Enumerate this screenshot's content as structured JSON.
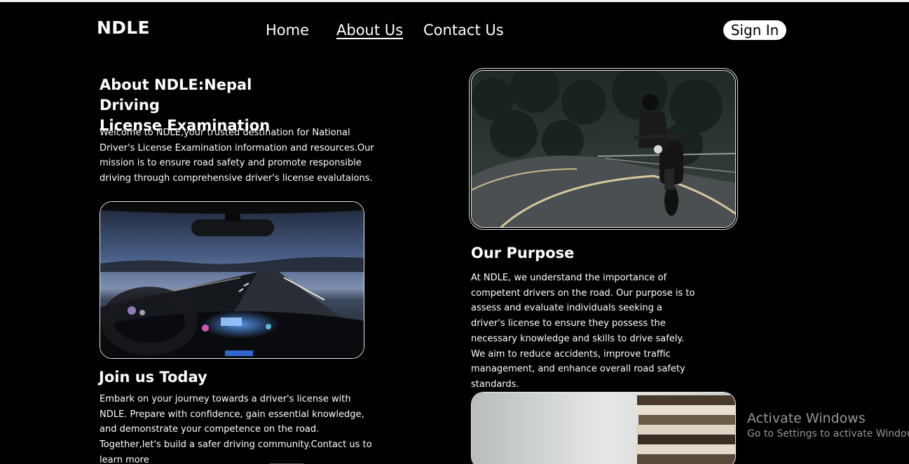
{
  "header": {
    "logo": "NDLE",
    "nav": [
      {
        "label": "Home"
      },
      {
        "label": "About Us"
      },
      {
        "label": "Contact Us"
      }
    ],
    "signin_label": "Sign In"
  },
  "about": {
    "heading_line1": "About NDLE:Nepal Driving",
    "heading_line2": "License Examination",
    "paragraph": "Welcome to NDLE,your trusted destination for National Driver's License Examination information and resources.Our mission is to ensure road safety and promote responsible driving through comprehensive driver's license evalutaions."
  },
  "purpose": {
    "heading": "Our Purpose",
    "paragraph": "At NDLE, we understand the importance of competent drivers on the road. Our purpose is to assess and evaluate individuals seeking a driver's license to ensure they possess the necessary knowledge and skills to drive safely. We aim to reduce accidents, improve traffic management, and enhance overall road safety standards."
  },
  "join": {
    "heading": "Join us Today",
    "paragraph": "Embark on your journey towards a driver's license with NDLE. Prepare with confidence, gain essential knowledge, and demonstrate your competence on the road. Together,let's build a safer driving community.Contact us to learn more"
  },
  "watermark": {
    "title": "Activate Windows",
    "subtitle": "Go to Settings to activate Windows."
  }
}
